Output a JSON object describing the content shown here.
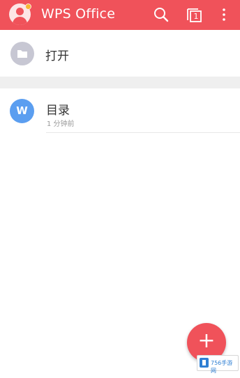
{
  "header": {
    "title": "WPS Office",
    "icons": [
      "avatar",
      "search-icon",
      "tabs-icon",
      "more-vert-icon"
    ],
    "tab_count": "1",
    "color": "#f0525a"
  },
  "open_row": {
    "label": "打开",
    "icon": "folder-icon"
  },
  "recent": [
    {
      "badge": "W",
      "name": "目录",
      "time": "1 分钟前"
    }
  ],
  "fab": {
    "symbol": "+"
  },
  "watermark": {
    "text": "756手游网"
  }
}
